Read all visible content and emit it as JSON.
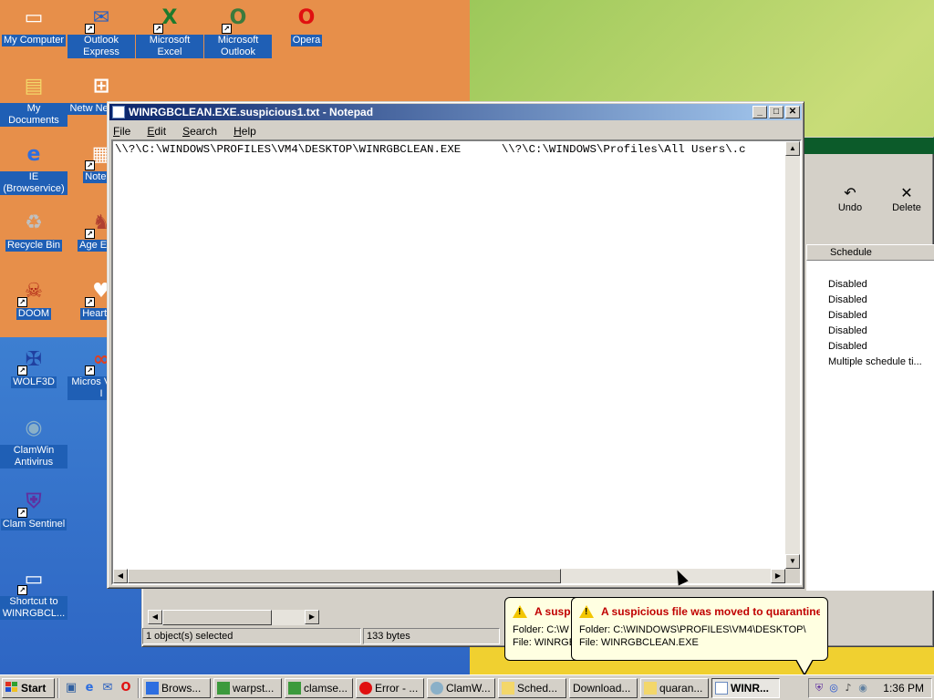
{
  "desktop": {
    "icons": [
      {
        "label": "My Computer",
        "icon": "my-computer-icon",
        "glyph": "▭",
        "color": "#ffffff"
      },
      {
        "label": "Outlook Express",
        "icon": "outlook-express-icon",
        "glyph": "✉",
        "color": "#2a60c0"
      },
      {
        "label": "Microsoft Excel",
        "icon": "excel-icon",
        "glyph": "X",
        "color": "#1d7a2c"
      },
      {
        "label": "Microsoft Outlook",
        "icon": "outlook-icon",
        "glyph": "O",
        "color": "#3c7a3c"
      },
      {
        "label": "Opera",
        "icon": "opera-icon",
        "glyph": "O",
        "color": "#e01010"
      },
      {
        "label": "My Documents",
        "icon": "my-documents-icon",
        "glyph": "▤",
        "color": "#f3d76a"
      },
      {
        "label": "Netw Neighbo",
        "icon": "network-neighborhood-icon",
        "glyph": "⊞",
        "color": "#ffffff"
      },
      {
        "label": "IE (Browservice)",
        "icon": "internet-explorer-icon",
        "glyph": "e",
        "color": "#2d6ee0"
      },
      {
        "label": "Notepa",
        "icon": "notepad-icon",
        "glyph": "▦",
        "color": "#ffffff"
      },
      {
        "label": "Recycle Bin",
        "icon": "recycle-bin-icon",
        "glyph": "♻",
        "color": "#c0c0c0"
      },
      {
        "label": "Age Empi",
        "icon": "age-of-empires-icon",
        "glyph": "♞",
        "color": "#b04030"
      },
      {
        "label": "DOOM",
        "icon": "doom-icon",
        "glyph": "☠",
        "color": "#b02818"
      },
      {
        "label": "Hearts o",
        "icon": "hearts-icon",
        "glyph": "♥",
        "color": "#ffffff"
      },
      {
        "label": "WOLF3D",
        "icon": "wolf3d-icon",
        "glyph": "✠",
        "color": "#2040a0"
      },
      {
        "label": "Micros Visual I",
        "icon": "visual-studio-icon",
        "glyph": "∞",
        "color": "#e04020"
      },
      {
        "label": "ClamWin Antivirus",
        "icon": "clamwin-icon",
        "glyph": "◉",
        "color": "#8ab0c8"
      },
      {
        "label": "Clam Sentinel",
        "icon": "clam-sentinel-icon",
        "glyph": "⛨",
        "color": "#6030a0"
      },
      {
        "label": "Shortcut to WINRGBCL...",
        "icon": "winrgbclean-shortcut-icon",
        "glyph": "▭",
        "color": "#ffffff"
      }
    ]
  },
  "background_window": {
    "toolbar": {
      "undo_label": "Undo",
      "delete_label": "Delete"
    },
    "column_header": "Schedule",
    "rows": [
      "Disabled",
      "Disabled",
      "Disabled",
      "Disabled",
      "Disabled",
      "Multiple schedule ti..."
    ],
    "status": {
      "selected": "1 object(s) selected",
      "size": "133 bytes"
    }
  },
  "notepad": {
    "title": "WINRGBCLEAN.EXE.suspicious1.txt - Notepad",
    "menu": [
      "File",
      "Edit",
      "Search",
      "Help"
    ],
    "content": "\\\\?\\C:\\WINDOWS\\PROFILES\\VM4\\DESKTOP\\WINRGBCLEAN.EXE      \\\\?\\C:\\WINDOWS\\Profiles\\All Users\\.c"
  },
  "balloons": {
    "back": {
      "title": "A suspi",
      "folder": "Folder: C:\\W",
      "file": "File: WINRGB"
    },
    "front": {
      "title": "A suspicious file was moved to quarantine!",
      "folder": "Folder: C:\\WINDOWS\\PROFILES\\VM4\\DESKTOP\\",
      "file": "File: WINRGBCLEAN.EXE"
    }
  },
  "taskbar": {
    "start_label": "Start",
    "quick_launch": [
      "show-desktop-icon",
      "ie-quicklaunch-icon",
      "outlook-quicklaunch-icon",
      "opera-quicklaunch-icon"
    ],
    "buttons": [
      {
        "label": "Brows...",
        "active": false
      },
      {
        "label": "warpst...",
        "active": false
      },
      {
        "label": "clamse...",
        "active": false
      },
      {
        "label": "Error - ...",
        "active": false
      },
      {
        "label": "ClamW...",
        "active": false
      },
      {
        "label": "Sched...",
        "active": false
      },
      {
        "label": "Download...",
        "active": false
      },
      {
        "label": "quaran...",
        "active": false
      },
      {
        "label": "WINR...",
        "active": true
      }
    ],
    "clock": "1:36 PM"
  },
  "colors": {
    "titlebar_start": "#0a246a",
    "titlebar_end": "#a6caf0",
    "face": "#d4d0c8",
    "balloon_bg": "#ffffe1",
    "balloon_title": "#c00000"
  }
}
